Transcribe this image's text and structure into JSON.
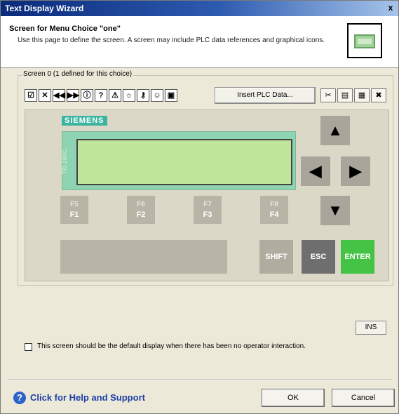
{
  "window": {
    "title": "Text Display Wizard",
    "close_glyph": "x"
  },
  "header": {
    "title": "Screen for Menu Choice \"one\"",
    "description": "Use this page to define the screen. A screen may include PLC data references and graphical icons.",
    "icon": "td-display-icon"
  },
  "group": {
    "label": "Screen 0 (1 defined for this choice)"
  },
  "toolbar": {
    "insert_label": "Insert PLC Data...",
    "icons": [
      "checkbox-checked-icon",
      "checkbox-x-icon",
      "rewind-icon",
      "fast-forward-icon",
      "info-icon",
      "question-icon",
      "warning-icon",
      "bulb-icon",
      "key-icon",
      "person-icon",
      "disk-icon"
    ],
    "right_icons": [
      "cut-icon",
      "copy-icon",
      "paste-icon",
      "delete-icon"
    ]
  },
  "device": {
    "brand": "SIEMENS",
    "model": "TD 200C",
    "fkeys": [
      {
        "top": "F5",
        "bottom": "F1"
      },
      {
        "top": "F6",
        "bottom": "F2"
      },
      {
        "top": "F7",
        "bottom": "F3"
      },
      {
        "top": "F8",
        "bottom": "F4"
      }
    ],
    "shift_label": "SHIFT",
    "esc_label": "ESC",
    "enter_label": "ENTER",
    "arrows": {
      "up": "▲",
      "left": "◀",
      "right": "▶",
      "down": "▼"
    },
    "colors": {
      "lcd": "#bfe59a",
      "enter": "#44c344",
      "brand_badge": "#3ab6a0"
    }
  },
  "ins_label": "INS",
  "default_display_label": "This screen should be the default display when there has been no operator interaction.",
  "default_display_checked": false,
  "help": {
    "label": "Click for Help and Support",
    "icon": "help-icon"
  },
  "buttons": {
    "ok": "OK",
    "cancel": "Cancel"
  }
}
